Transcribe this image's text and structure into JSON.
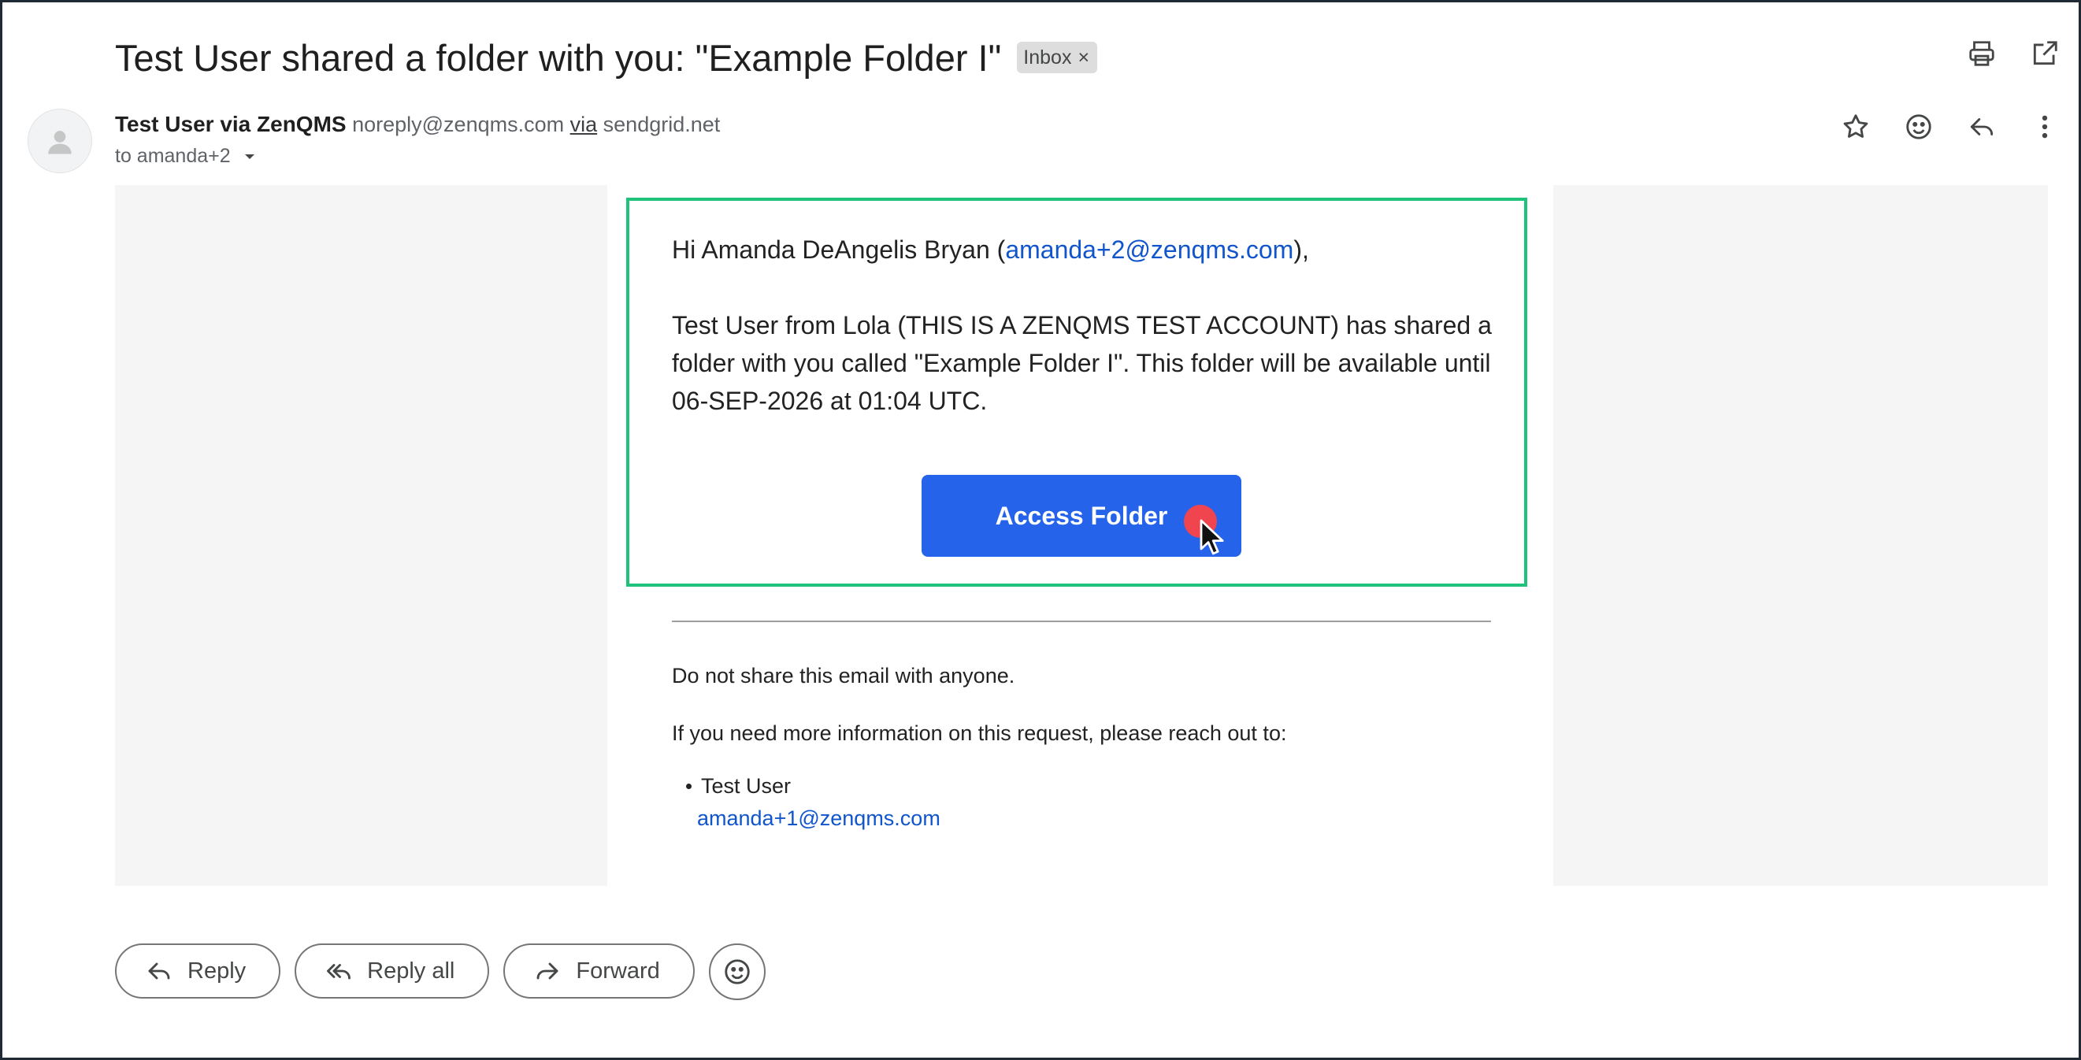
{
  "email": {
    "subject": "Test User shared a folder with you: \"Example Folder I\"",
    "label": "Inbox",
    "label_remove": "×",
    "sender_name": "Test User via ZenQMS",
    "sender_email": "noreply@zenqms.com",
    "via_word": "via",
    "via_domain": "sendgrid.net",
    "to_text": "to amanda+2"
  },
  "body": {
    "greeting_prefix": "Hi Amanda DeAngelis Bryan (",
    "greeting_email": "amanda+2@zenqms.com",
    "greeting_suffix": "),",
    "message": "Test User from Lola (THIS IS A ZENQMS TEST ACCOUNT) has shared a folder with you called \"Example Folder I\". This folder will be available until 06-SEP-2026 at 01:04 UTC.",
    "cta_label": "Access Folder",
    "notice": "Do not share this email with anyone.",
    "contact_intro": "If you need more information on this request, please reach out to:",
    "contact_name": "Test User",
    "contact_email": "amanda+1@zenqms.com"
  },
  "actions": {
    "reply": "Reply",
    "reply_all": "Reply all",
    "forward": "Forward"
  },
  "colors": {
    "cta": "#2563eb",
    "highlight": "#1fc27a",
    "link": "#1155cc",
    "click_marker": "#f0444f"
  },
  "icons": {
    "top": [
      "print-icon",
      "open-in-new-window-icon"
    ],
    "header": [
      "star-icon",
      "emoji-icon",
      "reply-icon",
      "more-vert-icon"
    ]
  }
}
